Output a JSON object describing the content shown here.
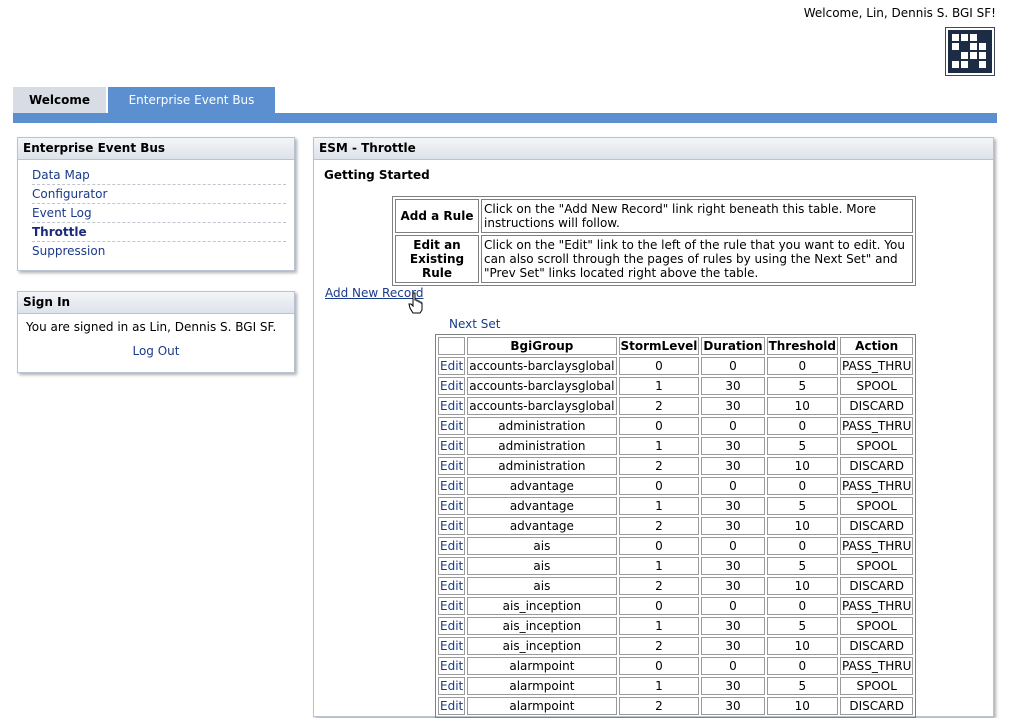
{
  "header": {
    "welcome": "Welcome, Lin, Dennis S. BGI SF!"
  },
  "tabs": [
    {
      "label": "Welcome"
    },
    {
      "label": "Enterprise Event Bus"
    }
  ],
  "sidebar": {
    "title": "Enterprise Event Bus",
    "items": [
      {
        "label": "Data Map"
      },
      {
        "label": "Configurator"
      },
      {
        "label": "Event Log"
      },
      {
        "label": "Throttle"
      },
      {
        "label": "Suppression"
      }
    ],
    "active": "Throttle"
  },
  "signin": {
    "title": "Sign In",
    "text": "You are signed in as Lin, Dennis S. BGI SF.",
    "logout": "Log Out"
  },
  "main": {
    "title": "ESM - Throttle",
    "getting_started": "Getting Started",
    "help": [
      {
        "label": "Add a Rule",
        "text": "Click on the \"Add New Record\" link right beneath this table. More instructions will follow."
      },
      {
        "label": "Edit an Existing Rule",
        "text": "Click on the \"Edit\" link to the left of the rule that you want to edit. You can also scroll through the pages of rules by using the Next Set\" and \"Prev Set\" links located right above the table."
      }
    ],
    "add_new": "Add New Record",
    "next_set": "Next Set",
    "table": {
      "headers": [
        "",
        "BgiGroup",
        "StormLevel",
        "Duration",
        "Threshold",
        "Action"
      ],
      "edit_label": "Edit",
      "rows": [
        [
          "accounts-barclaysglobal",
          "0",
          "0",
          "0",
          "PASS_THRU"
        ],
        [
          "accounts-barclaysglobal",
          "1",
          "30",
          "5",
          "SPOOL"
        ],
        [
          "accounts-barclaysglobal",
          "2",
          "30",
          "10",
          "DISCARD"
        ],
        [
          "administration",
          "0",
          "0",
          "0",
          "PASS_THRU"
        ],
        [
          "administration",
          "1",
          "30",
          "5",
          "SPOOL"
        ],
        [
          "administration",
          "2",
          "30",
          "10",
          "DISCARD"
        ],
        [
          "advantage",
          "0",
          "0",
          "0",
          "PASS_THRU"
        ],
        [
          "advantage",
          "1",
          "30",
          "5",
          "SPOOL"
        ],
        [
          "advantage",
          "2",
          "30",
          "10",
          "DISCARD"
        ],
        [
          "ais",
          "0",
          "0",
          "0",
          "PASS_THRU"
        ],
        [
          "ais",
          "1",
          "30",
          "5",
          "SPOOL"
        ],
        [
          "ais",
          "2",
          "30",
          "10",
          "DISCARD"
        ],
        [
          "ais_inception",
          "0",
          "0",
          "0",
          "PASS_THRU"
        ],
        [
          "ais_inception",
          "1",
          "30",
          "5",
          "SPOOL"
        ],
        [
          "ais_inception",
          "2",
          "30",
          "10",
          "DISCARD"
        ],
        [
          "alarmpoint",
          "0",
          "0",
          "0",
          "PASS_THRU"
        ],
        [
          "alarmpoint",
          "1",
          "30",
          "5",
          "SPOOL"
        ],
        [
          "alarmpoint",
          "2",
          "30",
          "10",
          "DISCARD"
        ]
      ]
    }
  },
  "colors": {
    "accent": "#5b8fd0",
    "tab_inactive": "#d8dde5",
    "link": "#1a3a8a"
  },
  "icons": {
    "logo": "company-logo-icon",
    "cursor": "hand-pointer-icon"
  }
}
